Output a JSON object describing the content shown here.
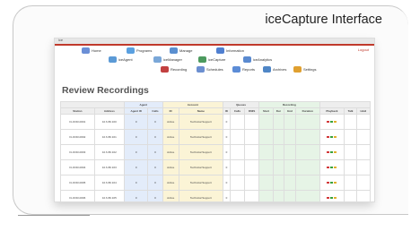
{
  "slide_title": "iceCapture Interface",
  "app": {
    "topbar_label": "ice",
    "logout_label": "Logout",
    "nav": {
      "row1": [
        {
          "label": "Home",
          "icon": "home-icon",
          "color": "#6b8fd6"
        },
        {
          "label": "Programs",
          "icon": "programs-icon",
          "color": "#5aa0e0"
        },
        {
          "label": "Manage",
          "icon": "manage-icon",
          "color": "#5a8fd0"
        },
        {
          "label": "Information",
          "icon": "info-icon",
          "color": "#4f7fd0"
        }
      ],
      "row2": [
        {
          "label": "iceAgent",
          "icon": "agent-icon",
          "color": "#5b9ad6"
        },
        {
          "label": "iceManager",
          "icon": "manager-icon",
          "color": "#7aa7d8"
        },
        {
          "label": "iceCapture",
          "icon": "capture-icon",
          "color": "#4c9a5e"
        },
        {
          "label": "iceAnalytics",
          "icon": "analytics-icon",
          "color": "#5a8ad0"
        }
      ],
      "row3": [
        {
          "label": "Recording",
          "icon": "recording-icon",
          "color": "#c24040"
        },
        {
          "label": "Schedules",
          "icon": "schedules-icon",
          "color": "#6c8fd0"
        },
        {
          "label": "Reports",
          "icon": "reports-icon",
          "color": "#5c8cd6"
        },
        {
          "label": "Archives",
          "icon": "archives-icon",
          "color": "#4f86c6"
        },
        {
          "label": "Settings",
          "icon": "settings-icon",
          "color": "#e0a030"
        }
      ]
    },
    "page_title": "Review Recordings",
    "table": {
      "group_headers": [
        "Agent",
        "Account",
        "Queues",
        "Recording"
      ],
      "headers": [
        "Station",
        "Address",
        "Agent ID",
        "Calls",
        "ID",
        "Name",
        "ID",
        "Calls",
        "DNIS",
        "Start",
        "Dur",
        "End",
        "Duration",
        "Playback",
        "Talk",
        "Hold"
      ],
      "rows": [
        [
          "FLOOR-0001",
          "10.6.80.160",
          "0",
          "0",
          "Active",
          "Technical Support",
          "0",
          "",
          "",
          "",
          "",
          "",
          "",
          "",
          "",
          ""
        ],
        [
          "FLOOR-0002",
          "10.6.80.161",
          "0",
          "0",
          "Active",
          "Technical Support",
          "0",
          "",
          "",
          "",
          "",
          "",
          "",
          "",
          "",
          ""
        ],
        [
          "FLOOR-0003",
          "10.6.80.162",
          "0",
          "0",
          "Active",
          "Technical Support",
          "0",
          "",
          "",
          "",
          "",
          "",
          "",
          "",
          "",
          ""
        ],
        [
          "FLOOR-0004",
          "10.6.80.163",
          "0",
          "0",
          "Active",
          "Technical Support",
          "0",
          "",
          "",
          "",
          "",
          "",
          "",
          "",
          "",
          ""
        ],
        [
          "FLOOR-0005",
          "10.6.80.164",
          "0",
          "0",
          "Active",
          "Technical Support",
          "0",
          "",
          "",
          "",
          "",
          "",
          "",
          "",
          "",
          ""
        ],
        [
          "FLOOR-0006",
          "10.6.80.165",
          "0",
          "0",
          "Active",
          "Technical Support",
          "0",
          "",
          "",
          "",
          "",
          "",
          "",
          "",
          "",
          ""
        ]
      ]
    }
  }
}
